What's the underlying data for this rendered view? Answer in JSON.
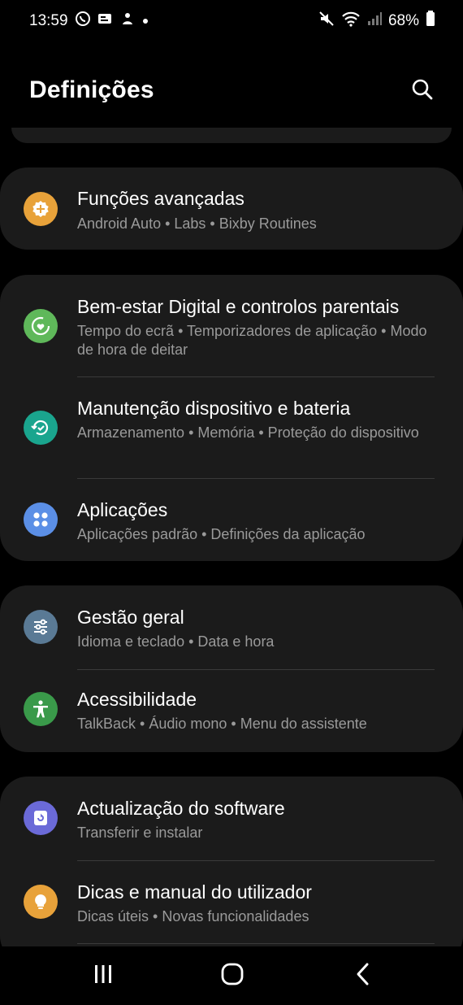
{
  "status_bar": {
    "time": "13:59",
    "battery": "68%",
    "icons_left": [
      "whatsapp-icon",
      "news-icon",
      "bixby-icon",
      "dot-icon"
    ],
    "icons_right": [
      "mute-icon",
      "wifi-icon",
      "signal-icon",
      "battery-icon"
    ]
  },
  "header": {
    "title": "Definições",
    "search_icon": "search-icon"
  },
  "colors": {
    "background": "#000000",
    "card": "#1b1b1b",
    "subtitle": "#9a9a9a",
    "advanced": "#e8a23a",
    "wellbeing": "#5fb85a",
    "maintenance": "#1aa58e",
    "apps": "#5b8fe6",
    "general": "#5a7a95",
    "accessibility": "#3a9a4a",
    "update": "#6b6ad8",
    "tips": "#e8a23a"
  },
  "sections": [
    {
      "items": [
        {
          "title": "Funções avançadas",
          "subtitle": "Android Auto  •  Labs  •  Bixby Routines",
          "icon": "advanced-features-icon"
        }
      ]
    },
    {
      "items": [
        {
          "title": "Bem-estar Digital e controlos parentais",
          "subtitle": "Tempo do ecrã  •  Temporizadores de aplicação  •  Modo de hora de deitar",
          "icon": "digital-wellbeing-icon"
        },
        {
          "title": "Manutenção dispositivo e bateria",
          "subtitle": "Armazenamento  •  Memória  •  Proteção do dispositivo",
          "icon": "device-care-icon"
        },
        {
          "title": "Aplicações",
          "subtitle": "Aplicações padrão  •  Definições da aplicação",
          "icon": "apps-icon"
        }
      ]
    },
    {
      "items": [
        {
          "title": "Gestão geral",
          "subtitle": "Idioma e teclado  •  Data e hora",
          "icon": "general-management-icon"
        },
        {
          "title": "Acessibilidade",
          "subtitle": "TalkBack  •  Áudio mono  •  Menu do assistente",
          "icon": "accessibility-icon"
        }
      ]
    },
    {
      "items": [
        {
          "title": "Actualização do software",
          "subtitle": "Transferir e instalar",
          "icon": "software-update-icon"
        },
        {
          "title": "Dicas e manual do utilizador",
          "subtitle": "Dicas úteis  •  Novas funcionalidades",
          "icon": "tips-icon"
        }
      ]
    }
  ],
  "nav_bar": {
    "recents": "recents-icon",
    "home": "home-icon",
    "back": "back-icon"
  }
}
